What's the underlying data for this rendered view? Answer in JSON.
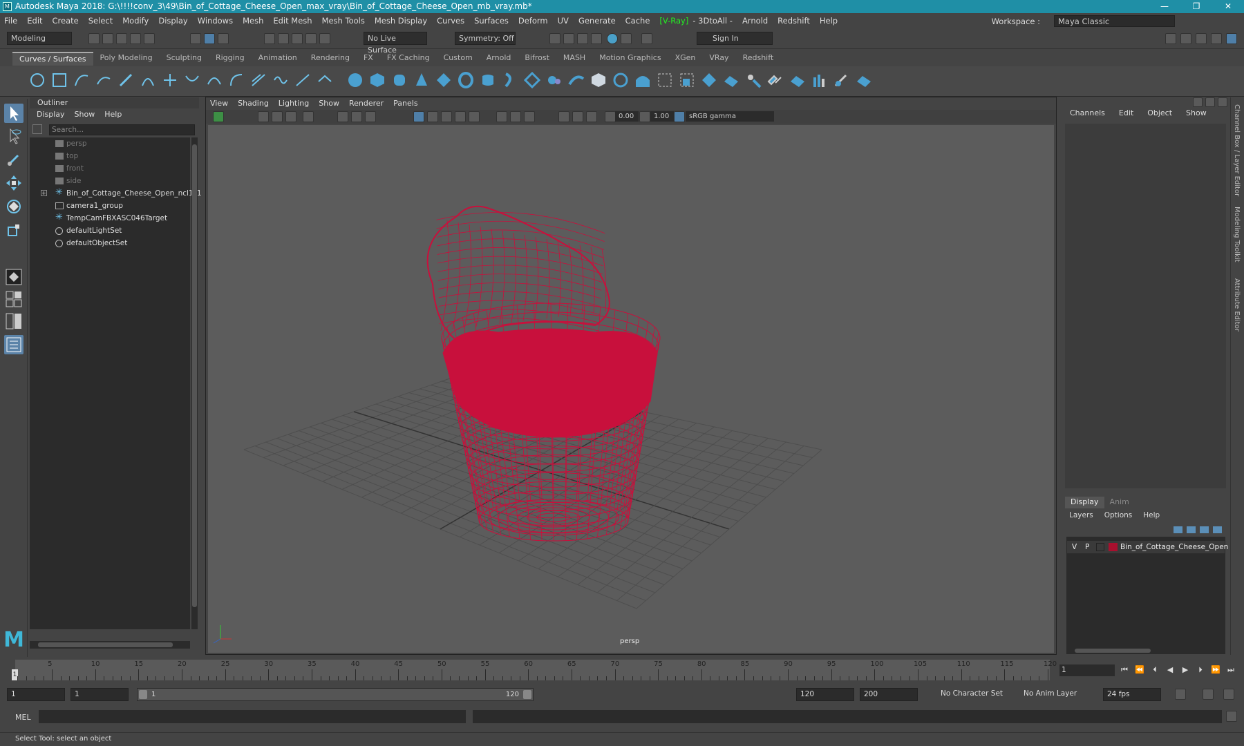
{
  "window": {
    "title": "Autodesk Maya 2018: G:\\!!!!conv_3\\49\\Bin_of_Cottage_Cheese_Open_max_vray\\Bin_of_Cottage_Cheese_Open_mb_vray.mb*",
    "app_icon": "M",
    "minimize": "—",
    "restore": "❐",
    "close": "✕"
  },
  "menubar": {
    "items": [
      "File",
      "Edit",
      "Create",
      "Select",
      "Modify",
      "Display",
      "Windows",
      "Mesh",
      "Edit Mesh",
      "Mesh Tools",
      "Mesh Display",
      "Curves",
      "Surfaces",
      "Deform",
      "UV",
      "Generate",
      "Cache"
    ],
    "vray": "[V-Ray]",
    "items2": [
      "- 3DtoAll -",
      "Arnold",
      "Redshift",
      "Help"
    ],
    "workspace_label": "Workspace :",
    "workspace_value": "Maya Classic"
  },
  "status": {
    "mode": "Modeling",
    "live_surface": "No Live Surface",
    "symmetry": "Symmetry: Off",
    "sign_in": "Sign In"
  },
  "shelf": {
    "tabs": [
      "Curves / Surfaces",
      "Poly Modeling",
      "Sculpting",
      "Rigging",
      "Animation",
      "Rendering",
      "FX",
      "FX Caching",
      "Custom",
      "Arnold",
      "Bifrost",
      "MASH",
      "Motion Graphics",
      "XGen",
      "VRay",
      "Redshift"
    ],
    "active": "Curves / Surfaces"
  },
  "outliner": {
    "title": "Outliner",
    "menu": [
      "Display",
      "Show",
      "Help"
    ],
    "search_placeholder": "Search...",
    "items": [
      {
        "label": "persp",
        "dim": true,
        "icon": "camera-icon"
      },
      {
        "label": "top",
        "dim": true,
        "icon": "camera-icon"
      },
      {
        "label": "front",
        "dim": true,
        "icon": "camera-icon"
      },
      {
        "label": "side",
        "dim": true,
        "icon": "camera-icon"
      },
      {
        "label": "Bin_of_Cottage_Cheese_Open_ncl1_1",
        "dim": false,
        "icon": "transform-icon",
        "expandable": true
      },
      {
        "label": "camera1_group",
        "dim": false,
        "icon": "group-icon"
      },
      {
        "label": "TempCamFBXASC046Target",
        "dim": false,
        "icon": "transform-icon"
      },
      {
        "label": "defaultLightSet",
        "dim": false,
        "icon": "set-icon"
      },
      {
        "label": "defaultObjectSet",
        "dim": false,
        "icon": "set-icon"
      }
    ]
  },
  "viewport": {
    "menu": [
      "View",
      "Shading",
      "Lighting",
      "Show",
      "Renderer",
      "Panels"
    ],
    "exposure": "0.00",
    "gamma": "1.00",
    "color_space": "sRGB gamma",
    "camera": "persp",
    "wire_color": "#c8103c"
  },
  "channel_box": {
    "menu": [
      "Channels",
      "Edit",
      "Object",
      "Show"
    ]
  },
  "layer_editor": {
    "tabs": [
      "Display",
      "Anim"
    ],
    "menu": [
      "Layers",
      "Options",
      "Help"
    ],
    "layer": {
      "v": "V",
      "p": "P",
      "name": "Bin_of_Cottage_Cheese_Open",
      "color": "#a8102e"
    }
  },
  "side_tabs": [
    "Channel Box / Layer Editor",
    "Modeling Toolkit",
    "Attribute Editor"
  ],
  "timeline": {
    "ticks": [
      "5",
      "10",
      "15",
      "20",
      "25",
      "30",
      "35",
      "40",
      "45",
      "50",
      "55",
      "60",
      "65",
      "70",
      "75",
      "80",
      "85",
      "90",
      "95",
      "100",
      "105",
      "110",
      "115",
      "120"
    ],
    "start": "1",
    "current_frame": "1"
  },
  "range": {
    "start": "1",
    "start2": "1",
    "slider_start": "1",
    "slider_end": "120",
    "end": "120",
    "end2": "200",
    "char_set": "No Character Set",
    "anim_layer": "No Anim Layer",
    "fps": "24 fps"
  },
  "command": {
    "label": "MEL"
  },
  "helpline": "Select Tool: select an object"
}
